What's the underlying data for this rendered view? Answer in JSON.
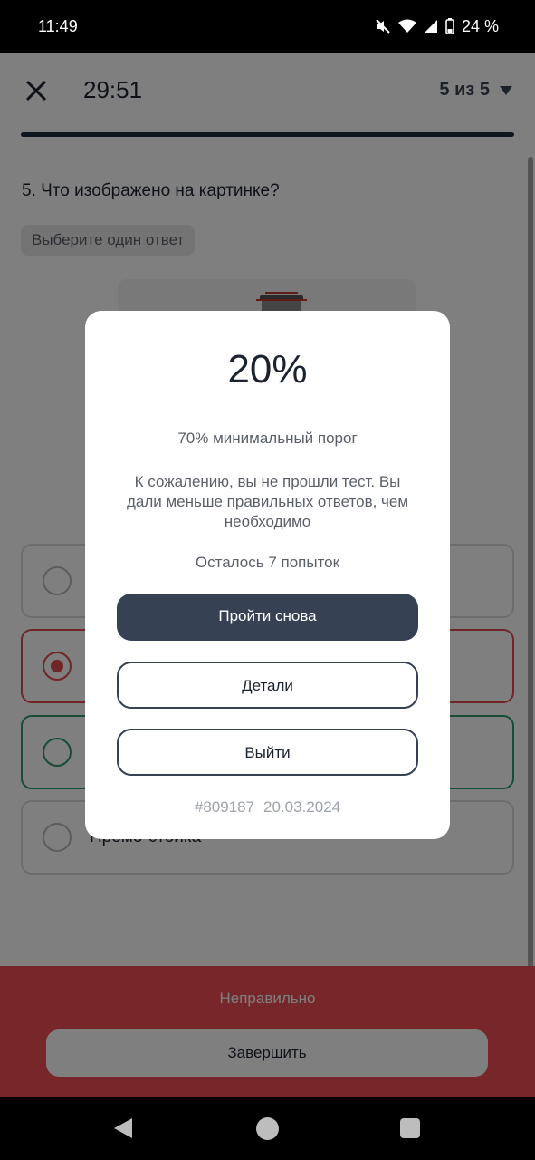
{
  "status_bar": {
    "time": "11:49",
    "battery_text": "24 %",
    "icons": [
      "mute-icon",
      "wifi-icon",
      "signal-icon",
      "battery-icon"
    ]
  },
  "header": {
    "timer": "29:51",
    "progress": "5 из 5"
  },
  "question": {
    "text": "5. Что изображено на картинке?",
    "hint": "Выберите один ответ"
  },
  "options": [
    {
      "label": "",
      "state": "default"
    },
    {
      "label": "",
      "state": "wrong"
    },
    {
      "label": "",
      "state": "correct"
    },
    {
      "label": "Промо-стойка",
      "state": "default"
    }
  ],
  "bottom": {
    "verdict": "Неправильно",
    "finish_label": "Завершить"
  },
  "modal": {
    "score": "20%",
    "threshold": "70% минимальный порог",
    "message": "К сожалению, вы не прошли тест. Вы дали меньше правильных ответов, чем необходимо",
    "attempts": "Осталось 7 попыток",
    "retry_label": "Пройти снова",
    "details_label": "Детали",
    "exit_label": "Выйти",
    "test_id": "#809187",
    "date": "20.03.2024"
  },
  "colors": {
    "accent_dark": "#364153",
    "error": "#e34a4f",
    "success": "#2e9a6b"
  }
}
